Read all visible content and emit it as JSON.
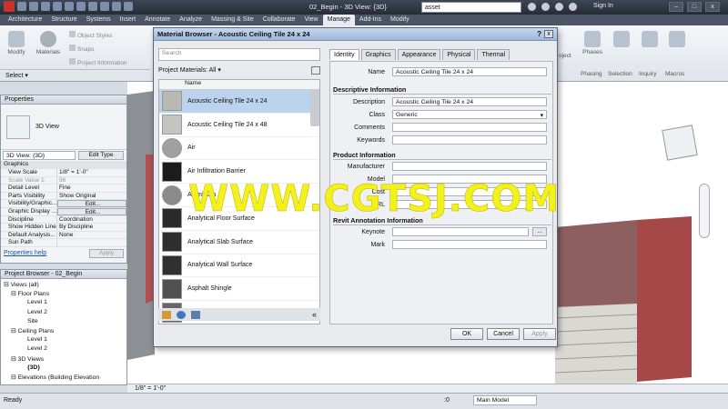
{
  "title_bar": {
    "document_title": "02_Begin - 3D View: {3D}",
    "search_value": "asset",
    "sign_in": "Sign In",
    "window_buttons": [
      "–",
      "□",
      "x"
    ]
  },
  "ribbon_tabs": [
    "Architecture",
    "Structure",
    "Systems",
    "Insert",
    "Annotate",
    "Analyze",
    "Massing & Site",
    "Collaborate",
    "View",
    "Manage",
    "Add-Ins",
    "Modify"
  ],
  "ribbon_active_tab": "Manage",
  "ribbon": {
    "modify": "Modify",
    "materials": "Materials",
    "object_styles": "Object Styles",
    "snaps": "Snaps",
    "project_information": "Project Information",
    "select_label": "Select ▾",
    "right_panels": [
      "Phases",
      "Phasing",
      "Selection",
      "Inquiry",
      "Macros"
    ],
    "project_cut": "oject"
  },
  "properties": {
    "header": "Properties",
    "type_name": "3D View",
    "selector": "3D View: {3D}",
    "edit_type": "Edit Type",
    "group": "Graphics",
    "rows": [
      {
        "k": "View Scale",
        "v": "1/8\" = 1'-0\""
      },
      {
        "k": "Scale Value    1:",
        "v": "96",
        "disabled": true
      },
      {
        "k": "Detail Level",
        "v": "Fine"
      },
      {
        "k": "Parts Visibility",
        "v": "Show Original"
      },
      {
        "k": "Visibility/Graphic...",
        "v": "Edit..."
      },
      {
        "k": "Graphic Display ...",
        "v": "Edit..."
      },
      {
        "k": "Discipline",
        "v": "Coordination"
      },
      {
        "k": "Show Hidden Lines",
        "v": "By Discipline"
      },
      {
        "k": "Default Analysis...",
        "v": "None"
      },
      {
        "k": "Sun Path",
        "v": ""
      }
    ],
    "help": "Properties help",
    "apply": "Apply"
  },
  "browser": {
    "header": "Project Browser - 02_Begin",
    "items": [
      {
        "t": "Views (all)",
        "lvl": 0
      },
      {
        "t": "Floor Plans",
        "lvl": 1
      },
      {
        "t": "Level 1",
        "lvl": 2
      },
      {
        "t": "Level 2",
        "lvl": 2
      },
      {
        "t": "Site",
        "lvl": 2
      },
      {
        "t": "Ceiling Plans",
        "lvl": 1
      },
      {
        "t": "Level 1",
        "lvl": 2
      },
      {
        "t": "Level 2",
        "lvl": 2
      },
      {
        "t": "3D Views",
        "lvl": 1
      },
      {
        "t": "{3D}",
        "lvl": 2
      },
      {
        "t": "Elevations (Building Elevation",
        "lvl": 1
      }
    ]
  },
  "dialog": {
    "title": "Material Browser - Acoustic Ceiling Tile 24 x 24",
    "help": "?",
    "close": "x",
    "search_placeholder": "Search",
    "filter_label": "Project Materials: All",
    "list_header": "Name",
    "materials": [
      {
        "name": "Acoustic Ceiling Tile 24 x 24",
        "selected": true,
        "color": "#b8b8b4"
      },
      {
        "name": "Acoustic Ceiling Tile 24 x 48",
        "color": "#c4c4c0"
      },
      {
        "name": "Air",
        "color": "#a0a0a0"
      },
      {
        "name": "Air Infiltration Barrier",
        "color": "#1c1c1c"
      },
      {
        "name": "Aluminum",
        "color": "#8a8a8a"
      },
      {
        "name": "Analytical Floor Surface",
        "color": "#2a2a2a"
      },
      {
        "name": "Analytical Slab Surface",
        "color": "#2e2e2e"
      },
      {
        "name": "Analytical Wall Surface",
        "color": "#303030"
      },
      {
        "name": "Asphalt Shingle",
        "color": "#505050"
      },
      {
        "name": "",
        "color": "#6b6464"
      }
    ],
    "tabs": [
      "Identity",
      "Graphics",
      "Appearance",
      "Physical",
      "Thermal"
    ],
    "active_tab": "Identity",
    "name_label": "Name",
    "name_value": "Acoustic Ceiling Tile 24 x 24",
    "descriptive_header": "Descriptive Information",
    "description_label": "Description",
    "description_value": "Acoustic Ceiling Tile 24 x 24",
    "class_label": "Class",
    "class_value": "Generic",
    "comments_label": "Comments",
    "keywords_label": "Keywords",
    "product_header": "Product Information",
    "manufacturer_label": "Manufacturer",
    "model_label": "Model",
    "cost_label": "Cost",
    "url_label": "URL",
    "annotation_header": "Revit Annotation Information",
    "keynote_label": "Keynote",
    "keynote_button": "...",
    "mark_label": "Mark",
    "ok": "OK",
    "cancel": "Cancel",
    "apply": "Apply",
    "collapse": "«"
  },
  "view_bar": {
    "scale": "1/8\" = 1'-0\""
  },
  "status_bar": {
    "ready": "Ready",
    "zero": ":0",
    "model": "Main Model"
  },
  "watermark": "WWW.CGTSJ.COM"
}
